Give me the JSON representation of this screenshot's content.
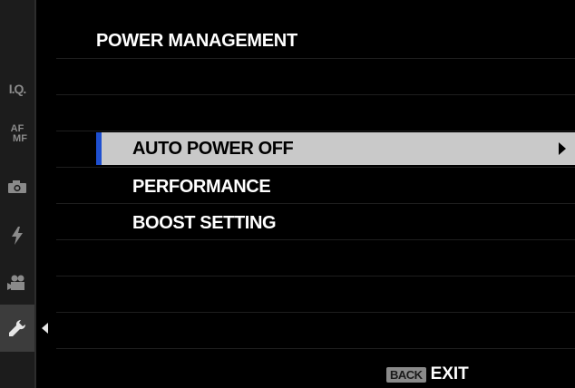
{
  "title": "POWER MANAGEMENT",
  "tabs": [
    {
      "id": "iq",
      "label": "I.Q.",
      "icon": "image-quality-icon"
    },
    {
      "id": "af",
      "label_top": "AF",
      "label_bottom": "MF",
      "icon": "af-mf-icon"
    },
    {
      "id": "shooting",
      "icon": "camera-icon"
    },
    {
      "id": "flash",
      "icon": "flash-icon"
    },
    {
      "id": "movie",
      "icon": "movie-camera-icon"
    },
    {
      "id": "setup",
      "icon": "wrench-icon",
      "active": true
    }
  ],
  "menu": {
    "items": [
      {
        "label": "AUTO POWER OFF",
        "selected": true
      },
      {
        "label": "PERFORMANCE",
        "selected": false
      },
      {
        "label": "BOOST SETTING",
        "selected": false
      }
    ]
  },
  "footer": {
    "back_key": "BACK",
    "exit_label": "EXIT"
  },
  "colors": {
    "background": "#000000",
    "selection": "#c9c9c9",
    "selection_marker": "#1e4fd0",
    "active_tab": "#3c3c3c"
  }
}
